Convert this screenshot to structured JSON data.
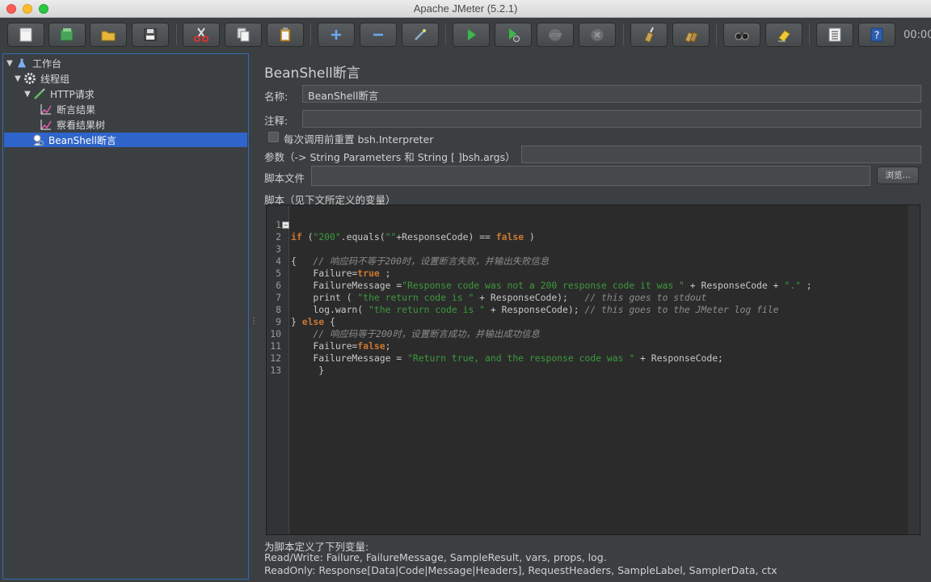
{
  "window": {
    "title": "Apache JMeter (5.2.1)"
  },
  "toolbar": {
    "buttons": [
      "new-icon",
      "templates-icon",
      "open-icon",
      "save-icon",
      "cut-icon",
      "copy-icon",
      "paste-icon",
      "expand-icon",
      "collapse-icon",
      "toggle-icon",
      "start-icon",
      "start-no-pause-icon",
      "stop-icon",
      "shutdown-icon",
      "clear-icon",
      "clear-all-icon",
      "search-icon",
      "reset-search-icon",
      "function-helper-icon",
      "help-icon"
    ],
    "timer": "00:00"
  },
  "tree": {
    "items": [
      {
        "label": "工作台",
        "icon": "test-plan-icon"
      },
      {
        "label": "线程组",
        "icon": "gear-icon"
      },
      {
        "label": "HTTP请求",
        "icon": "sampler-icon"
      },
      {
        "label": "断言结果",
        "icon": "listener-icon"
      },
      {
        "label": "察看结果树",
        "icon": "listener-icon"
      },
      {
        "label": "BeanShell断言",
        "icon": "assertion-icon"
      }
    ]
  },
  "panel": {
    "title": "BeanShell断言",
    "name_label": "名称:",
    "name_value": "BeanShell断言",
    "comment_label": "注释:",
    "comment_value": "",
    "reset_checkbox_label": "每次调用前重置 bsh.Interpreter",
    "params_label": "参数（-> String Parameters 和 String [ ]bsh.args）",
    "params_value": "",
    "script_file_label": "脚本文件",
    "script_file_value": "",
    "browse_label": "浏览...",
    "script_label": "脚本（见下文所定义的变量）"
  },
  "script": {
    "line_numbers": [
      "1",
      "2",
      "3",
      "4",
      "5",
      "6",
      "7",
      "8",
      "9",
      "10",
      "11",
      "12",
      "13"
    ]
  },
  "vars": {
    "title": "为脚本定义了下列变量:",
    "read_write": "Read/Write: Failure, FailureMessage, SampleResult, vars, props, log.",
    "read_only": "ReadOnly: Response[Data|Code|Message|Headers], RequestHeaders, SampleLabel, SamplerData, ctx"
  },
  "colors": {
    "background": "#3c3f41",
    "selection": "#2f65ca",
    "keyword": "#cc7832",
    "string": "#3c9a3c",
    "comment": "#8c8c8c"
  }
}
